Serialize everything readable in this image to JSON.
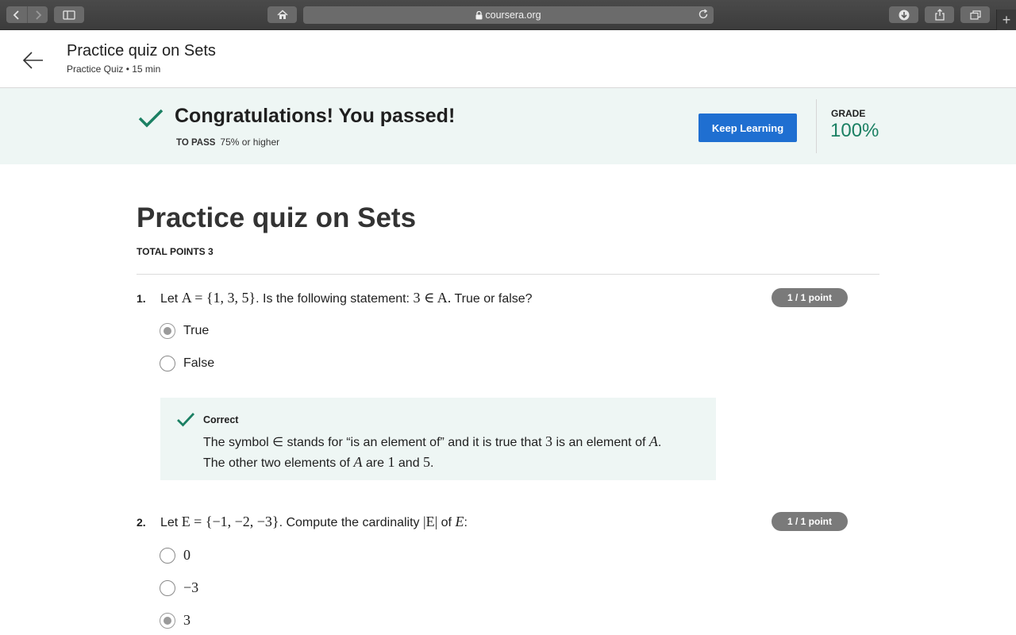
{
  "browser": {
    "url": "coursera.org"
  },
  "header": {
    "title": "Practice quiz on Sets",
    "subtitle": "Practice Quiz • 15 min"
  },
  "banner": {
    "message": "Congratulations! You passed!",
    "to_pass_label": "TO PASS",
    "to_pass_value": "75% or higher",
    "button_label": "Keep Learning",
    "grade_label": "GRADE",
    "grade_value": "100%",
    "accent_color": "#1b8063",
    "button_color": "#1f6fd1"
  },
  "quiz": {
    "title": "Practice quiz on Sets",
    "total_points": "TOTAL POINTS 3",
    "questions": [
      {
        "number": "1.",
        "text_lead": "Let ",
        "math_1": "A = {1, 3, 5}",
        "text_mid": ". Is the following statement: ",
        "math_2": "3 ∈ A.",
        "text_tail": " True or false?",
        "points": "1 / 1 point",
        "options": [
          "True",
          "False"
        ],
        "selected": "True",
        "feedback": {
          "title": "Correct",
          "line1_a": "The symbol ∈ stands for “is an element of” and it is true that ",
          "line1_m1": "3",
          "line1_b": " is an element of ",
          "line1_m2": "A",
          "line1_c": ".",
          "line2_a": "The other two elements of ",
          "line2_m1": "A",
          "line2_b": " are ",
          "line2_m2": "1",
          "line2_c": " and ",
          "line2_m3": "5",
          "line2_d": "."
        }
      },
      {
        "number": "2.",
        "text_lead": "Let ",
        "math_1": "E = {−1, −2, −3}",
        "text_mid": ". Compute the cardinality ",
        "math_2": "|E|",
        "text_tail": " of ",
        "math_3": "E",
        "text_end": ":",
        "points": "1 / 1 point",
        "options": [
          "0",
          "−3",
          "3"
        ],
        "selected": "3"
      }
    ]
  }
}
